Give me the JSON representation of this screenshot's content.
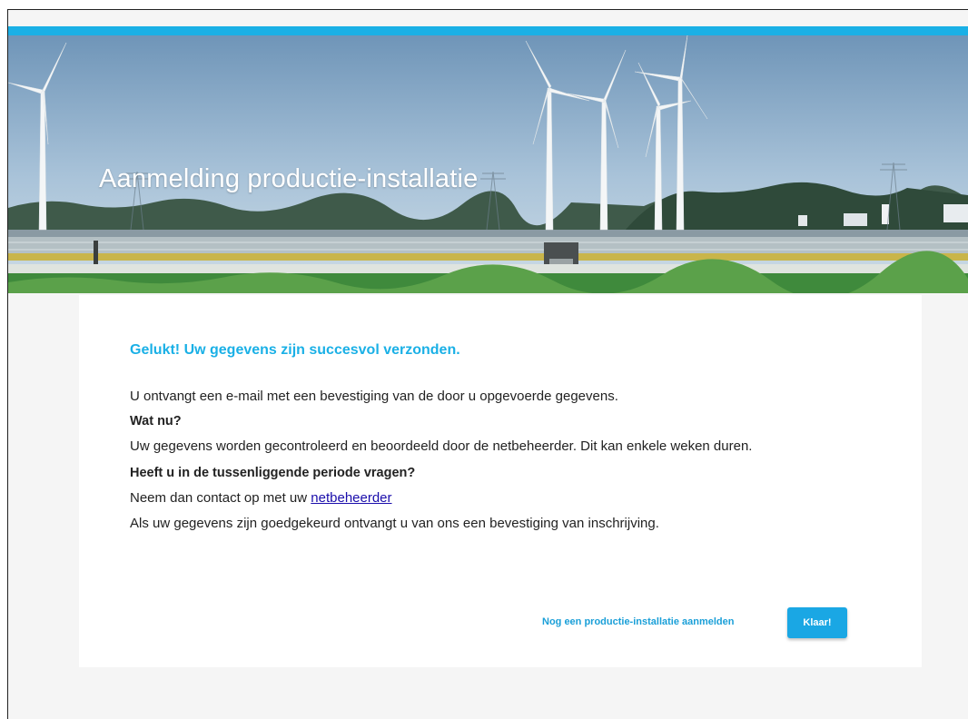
{
  "hero": {
    "title": "Aanmelding productie-installatie"
  },
  "confirmation": {
    "heading": "Gelukt! Uw gegevens zijn succesvol verzonden.",
    "email_notice": "U ontvangt een e-mail met een bevestiging van de door u opgevoerde gegevens.",
    "next_heading": "Wat nu?",
    "next_text": "Uw gegevens worden gecontroleerd en beoordeeld door de netbeheerder. Dit kan enkele weken duren.",
    "questions_heading": "Heeft u in de tussenliggende periode vragen?",
    "contact_prefix": "Neem dan contact op met uw ",
    "contact_link": "netbeheerder",
    "approval_text": "Als uw gegevens zijn goedgekeurd ontvangt u van ons een bevestiging van inschrijving."
  },
  "actions": {
    "another_label": "Nog een productie-installatie aanmelden",
    "done_label": "Klaar!"
  },
  "colors": {
    "accent": "#1ab0e6",
    "link": "#1a0dab",
    "button": "#1aa7e4"
  }
}
